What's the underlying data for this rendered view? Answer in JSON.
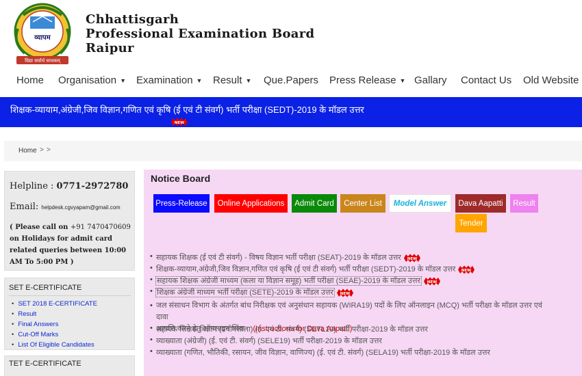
{
  "header": {
    "title_line1": "Chhattisgarh",
    "title_line2": "Professional Examination Board",
    "title_line3": "Raipur",
    "logo_text": "व्यापम",
    "logo_ring_text": "CHHATTISGARH PROFESSIONAL EXAMINATION BOARD",
    "logo_motto": "विद्या सर्वार्थ साधकम्"
  },
  "nav": {
    "items": [
      {
        "label": "Home"
      },
      {
        "label": "Organisation"
      },
      {
        "label": "Examination"
      },
      {
        "label": "Result"
      },
      {
        "label": "Que.Papers"
      },
      {
        "label": "Press Release"
      },
      {
        "label": "Gallary"
      },
      {
        "label": "Contact Us"
      },
      {
        "label": "Old Website"
      }
    ]
  },
  "ticker": {
    "text": "शिक्षक-व्यायाम,अंग्रेजी,जिव विज्ञान,गणित एवं कृषि (ई एवं टी संवर्ग) भर्ती परीक्षा (SEDT)-2019 के मॉडल उत्तर",
    "badge": "NEW"
  },
  "breadcrumb": {
    "home": "Home",
    "sep1": ">",
    "sep2": ">"
  },
  "sidebar": {
    "helpline_label": "Helpline :",
    "helpline_number": "0771-2972780",
    "email_label": "Email:",
    "email_value": "helpdesk.cgvyapam@gmail.com",
    "holiday_prefix": "( Please call on",
    "holiday_phone": "+91 7470470609",
    "holiday_rest": "on Holidays for admit card related queries between 10:00 AM To 5:00 PM )",
    "set_heading": "SET E-CERTIFICATE",
    "set_items": [
      "SET 2018 E-CERTIFICATE",
      "Result",
      "Final Answers",
      "Cut-Off Marks",
      "List Of Eligible Candidates"
    ],
    "tet_heading": "TET E-CERTIFICATE"
  },
  "notice_board": {
    "title": "Notice Board",
    "tabs": [
      {
        "label": "Press-Release",
        "bg": "#0b0bff",
        "color": "#ffffff"
      },
      {
        "label": "Online Applications",
        "bg": "#ff0000",
        "color": "#ffffff"
      },
      {
        "label": "Admit Card",
        "bg": "#0a8a0a",
        "color": "#ffffff"
      },
      {
        "label": "Center List",
        "bg": "#c9861c",
        "color": "#ffffff"
      },
      {
        "label": "Model Answer",
        "bg": "#ffffff",
        "color": "#1ab0d8"
      },
      {
        "label": "Dava Aapatti",
        "bg": "#9e2a2a",
        "color": "#ffffff"
      },
      {
        "label": "Result",
        "bg": "#ee82ee",
        "color": "#ffffff"
      },
      {
        "label": "Tender",
        "bg": "#ffa500",
        "color": "#ffffff"
      }
    ],
    "items": [
      {
        "text": "सहायक शिक्षक (ई एवं टी संवर्ग) - विषय विज्ञान भर्ती परीक्षा (SEAT)-2019 के मॉडल उत्तर"
      },
      {
        "text": "शिक्षक-व्यायाम,अंग्रेजी,जिव विज्ञान,गणित एवं कृषि (ई एवं टी संवर्ग) भर्ती परीक्षा (SEDT)-2019 के मॉडल उत्तर"
      },
      {
        "text": "सहायक शिक्षक अंग्रेजी माध्यम (कला या विज्ञान समूह) भर्ती परीक्षा (SEAE)-2019 के मॉडल उत्तर"
      },
      {
        "text": "शिक्षक अंग्रेजी माध्यम भर्ती परीक्षा (SETE)-2019 के मॉडल उत्तर"
      },
      {
        "text_line1": "जल संसाधन विभाग के अंतर्गत बांध निरीक्षक एवं अनुसंधान सहायक (WIRA19) पदों के लिए ऑनलाइन (MCQ) भर्ती परीक्षा के मॉडल उत्तर एवं दावा",
        "text_line2": "आपत्ति करने हेतु ऑनलाइन लिंक",
        "link": "(Instructions for Dava Aapatti)"
      },
      {
        "text": "सहायक शिक्षक विज्ञान (प्रयोगशाला) (ई. एवं टी. संवर्ग) (SETL19) भर्ती परीक्षा-2019 के  मॉडल उत्तर"
      },
      {
        "text": "व्याख्याता (अंग्रेजी)  (ई. एवं टी. संवर्ग) (SELE19) भर्ती परीक्षा-2019 के मॉडल उत्तर"
      },
      {
        "text": "व्याख्याता (गणित, भौतिकी, रसायन, जीव विज्ञान, वाणिज्य) (ई. एवं टी. संवर्ग)  (SELA19) भर्ती परीक्षा-2019 के मॉडल उत्तर"
      }
    ],
    "new_badge": "NEW"
  },
  "colors": {
    "ticker_bg": "#0b21e6",
    "notice_bg": "#f6d8f4",
    "link_blue": "#0a2ad0",
    "alert_red": "#d10000"
  }
}
